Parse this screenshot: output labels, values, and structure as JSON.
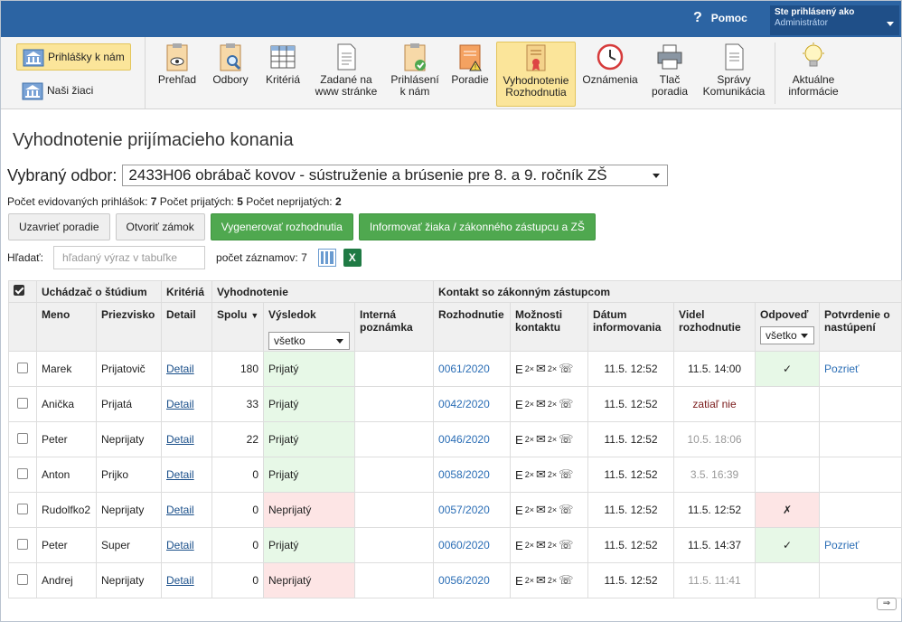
{
  "header": {
    "help_label": "Pomoc",
    "help_icon": "question-icon",
    "user_title": "Ste prihlásený ako",
    "user_name": "Administrátor"
  },
  "ribbon": {
    "left": [
      {
        "label": "Prihlášky k nám",
        "icon": "bank-icon",
        "active": true
      },
      {
        "label": "Naši žiaci",
        "icon": "bank-icon",
        "active": false
      }
    ],
    "tools": [
      {
        "label": "Prehľad",
        "icon": "clipboard-eye-icon"
      },
      {
        "label": "Odbory",
        "icon": "clipboard-search-icon"
      },
      {
        "label": "Kritériá",
        "icon": "table-icon"
      },
      {
        "label": "Zadané na\nwww stránke",
        "icon": "document-icon"
      },
      {
        "label": "Prihlásení\nk nám",
        "icon": "clipboard-check-icon"
      },
      {
        "label": "Poradie",
        "icon": "warning-document-icon"
      },
      {
        "label": "Vyhodnotenie\nRozhodnutia",
        "icon": "certificate-icon",
        "active": true
      },
      {
        "label": "Oznámenia",
        "icon": "clock-icon"
      },
      {
        "label": "Tlač\nporadia",
        "icon": "printer-icon"
      },
      {
        "label": "Správy\nKomunikácia",
        "icon": "document-icon"
      },
      {
        "label": "Aktuálne\ninformácie",
        "icon": "lightbulb-icon"
      }
    ]
  },
  "page": {
    "title": "Vyhodnotenie prijímacieho konania",
    "odbor_label": "Vybraný odbor:",
    "odbor_value": "2433H06 obrábač kovov - sústruženie a brúsenie pre 8. a 9. ročník ZŠ",
    "stats": {
      "evid_label": "Počet evidovaných prihlášok:",
      "evid": "7",
      "prij_label": "Počet prijatých:",
      "prij": "5",
      "neprij_label": "Počet neprijatých:",
      "neprij": "2"
    },
    "buttons": {
      "close": "Uzavrieť poradie",
      "open": "Otvoriť zámok",
      "generate": "Vygenerovať rozhodnutia",
      "inform": "Informovať žiaka / zákonného zástupcu a ZŠ"
    },
    "search_label": "Hľadať:",
    "search_placeholder": "hľadaný výraz v tabuľke",
    "count_label": "počet záznamov: 7",
    "excel_letter": "X"
  },
  "table": {
    "groups": {
      "student": "Uchádzač o štúdium",
      "criteria": "Kritériá",
      "eval": "Vyhodnotenie",
      "contact": "Kontakt so zákonným zástupcom"
    },
    "cols": {
      "meno": "Meno",
      "priezvisko": "Priezvisko",
      "detail": "Detail",
      "spolu": "Spolu",
      "vysledok": "Výsledok",
      "poznamka": "Interná poznámka",
      "rozhodnutie": "Rozhodnutie",
      "moznosti": "Možnosti kontaktu",
      "datum": "Dátum informovania",
      "videl": "Videl rozhodnutie",
      "odpoved": "Odpoveď",
      "potvrdenie": "Potvrdenie o nastúpení"
    },
    "filter_vysledok": "všetko",
    "filter_odpoved": "všetko",
    "contact_e": "E",
    "contact_mult": "2×",
    "rows": [
      {
        "meno": "Marek",
        "priezvisko": "Prijatovič",
        "detail": "Detail",
        "spolu": "180",
        "vysledok": "Prijatý",
        "ok": true,
        "rozhodnutie": "0061/2020",
        "datum": "11.5. 12:52",
        "videl": "11.5. 14:00",
        "videl_style": "normal",
        "odpoved": "✓",
        "odp_bg": "green",
        "potvrdenie": "Pozrieť"
      },
      {
        "meno": "Anička",
        "priezvisko": "Prijatá",
        "detail": "Detail",
        "spolu": "33",
        "vysledok": "Prijatý",
        "ok": true,
        "rozhodnutie": "0042/2020",
        "datum": "11.5. 12:52",
        "videl": "zatiaľ nie",
        "videl_style": "red",
        "odpoved": "",
        "odp_bg": "none",
        "potvrdenie": ""
      },
      {
        "meno": "Peter",
        "priezvisko": "Neprijaty",
        "detail": "Detail",
        "spolu": "22",
        "vysledok": "Prijatý",
        "ok": true,
        "rozhodnutie": "0046/2020",
        "datum": "11.5. 12:52",
        "videl": "10.5. 18:06",
        "videl_style": "muted",
        "odpoved": "",
        "odp_bg": "none",
        "potvrdenie": ""
      },
      {
        "meno": "Anton",
        "priezvisko": "Prijko",
        "detail": "Detail",
        "spolu": "0",
        "vysledok": "Prijatý",
        "ok": true,
        "rozhodnutie": "0058/2020",
        "datum": "11.5. 12:52",
        "videl": "3.5. 16:39",
        "videl_style": "muted",
        "odpoved": "",
        "odp_bg": "none",
        "potvrdenie": ""
      },
      {
        "meno": "Rudolfko2",
        "priezvisko": "Neprijaty",
        "detail": "Detail",
        "spolu": "0",
        "vysledok": "Neprijatý",
        "ok": false,
        "rozhodnutie": "0057/2020",
        "datum": "11.5. 12:52",
        "videl": "11.5. 12:52",
        "videl_style": "normal",
        "odpoved": "✗",
        "odp_bg": "red",
        "potvrdenie": ""
      },
      {
        "meno": "Peter",
        "priezvisko": "Super",
        "detail": "Detail",
        "spolu": "0",
        "vysledok": "Prijatý",
        "ok": true,
        "rozhodnutie": "0060/2020",
        "datum": "11.5. 12:52",
        "videl": "11.5. 14:37",
        "videl_style": "normal",
        "odpoved": "✓",
        "odp_bg": "green",
        "potvrdenie": "Pozrieť"
      },
      {
        "meno": "Andrej",
        "priezvisko": "Neprijaty",
        "detail": "Detail",
        "spolu": "0",
        "vysledok": "Neprijatý",
        "ok": false,
        "rozhodnutie": "0056/2020",
        "datum": "11.5. 12:52",
        "videl": "11.5. 11:41",
        "videl_style": "muted",
        "odpoved": "",
        "odp_bg": "none",
        "potvrdenie": ""
      }
    ]
  },
  "colors": {
    "topbar": "#2c64a3",
    "accent_green": "#4fa84f",
    "row_ok": "#e7f8e7",
    "row_fail": "#fde5e5"
  }
}
